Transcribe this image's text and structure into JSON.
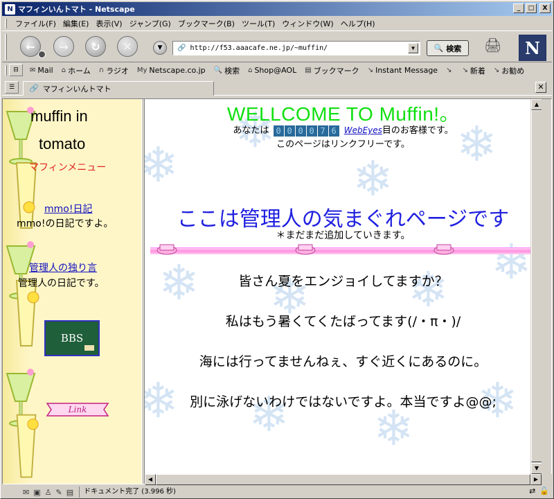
{
  "window": {
    "title": "マフィンいんトマト - Netscape",
    "controls": {
      "minimize": "_",
      "maximize": "□",
      "close": "X"
    }
  },
  "menu": {
    "items": [
      "ファイル(F)",
      "編集(E)",
      "表示(V)",
      "ジャンプ(G)",
      "ブックマーク(B)",
      "ツール(T)",
      "ウィンドウ(W)",
      "ヘルプ(H)"
    ]
  },
  "nav": {
    "url": "http://f53.aaacafe.ne.jp/~muffin/",
    "search_label": "検索",
    "logo": "N"
  },
  "personal_toolbar": {
    "items": [
      {
        "label": "Mail",
        "icon": "mail-icon"
      },
      {
        "label": "ホーム",
        "icon": "home-icon"
      },
      {
        "label": "ラジオ",
        "icon": "radio-icon"
      },
      {
        "label": "Netscape.co.jp",
        "icon": "my-netscape-icon"
      },
      {
        "label": "検索",
        "icon": "search-icon"
      },
      {
        "label": "Shop@AOL",
        "icon": "shop-icon"
      },
      {
        "label": "ブックマーク",
        "icon": "bookmark-icon"
      },
      {
        "label": "Instant Message",
        "icon": "link-icon"
      },
      {
        "label": "新着",
        "icon": "link-icon"
      },
      {
        "label": "お勧め",
        "icon": "link-icon"
      }
    ],
    "small_icon_label": "My"
  },
  "tabs": {
    "active": "マフィンいんトマト"
  },
  "left_frame": {
    "title_line1": "muffin in",
    "title_line2": "tomato",
    "menu_heading": "マフィンメニュー",
    "diary_link": "mmo!日記",
    "diary_desc": "mmo!の日記ですよ。",
    "admin_link": "管理人の独り言",
    "admin_desc": "管理人の日記です。",
    "bbs_label": "BBS",
    "link_banner": "Link"
  },
  "main": {
    "welcome": "WELLCOME TO Muffin!。",
    "visitor_prefix": "あなたは",
    "counter_digits": [
      "0",
      "0",
      "0",
      "0",
      "7",
      "6"
    ],
    "webeyes": "WebEyes",
    "visitor_suffix": "目のお客様です。",
    "linkfree": "このページはリンクフリーです。",
    "heading": "ここは管理人の気まぐれページです",
    "subheading": "＊まだまだ追加していきます。",
    "messages": [
      "皆さん夏をエンジョイしてますか？",
      "私はもう暑くてくたばってます(/・π・)/",
      "海には行ってませんねぇ、すぐ近くにあるのに。",
      "別に泳げないわけではないですよ。本当ですよ@@;"
    ]
  },
  "status": {
    "text": "ドキュメント完了 (3.996 秒)"
  },
  "colors": {
    "welcome": "#10e010",
    "heading": "#2020e0",
    "menu_heading": "#e02020",
    "link": "#1010c0",
    "left_bg": "#fff6c8"
  }
}
